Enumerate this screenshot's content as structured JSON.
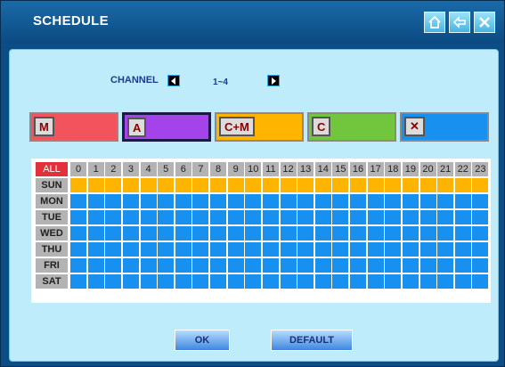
{
  "window": {
    "title": "SCHEDULE",
    "buttons": [
      {
        "name": "home-button",
        "icon": "home-icon"
      },
      {
        "name": "back-button",
        "icon": "back-arrow-icon"
      },
      {
        "name": "close-button",
        "icon": "close-icon"
      }
    ]
  },
  "channel": {
    "label": "CHANNEL",
    "value": "1~4"
  },
  "modes": [
    {
      "key": "m",
      "label": "M",
      "color": "#f2535c"
    },
    {
      "key": "a",
      "label": "A",
      "color": "#a543ea",
      "selected": true
    },
    {
      "key": "cm",
      "label": "C+M",
      "color": "#ffb400"
    },
    {
      "key": "c",
      "label": "C",
      "color": "#72c63d"
    },
    {
      "key": "none",
      "label": "✕",
      "color": "#1790f0"
    }
  ],
  "grid": {
    "all_label": "ALL",
    "hours": [
      "0",
      "1",
      "2",
      "3",
      "4",
      "5",
      "6",
      "7",
      "8",
      "9",
      "10",
      "11",
      "12",
      "13",
      "14",
      "15",
      "16",
      "17",
      "18",
      "19",
      "20",
      "21",
      "22",
      "23"
    ],
    "days": [
      {
        "label": "SUN",
        "mode": "cm"
      },
      {
        "label": "MON",
        "mode": "none"
      },
      {
        "label": "TUE",
        "mode": "none"
      },
      {
        "label": "WED",
        "mode": "none"
      },
      {
        "label": "THU",
        "mode": "none"
      },
      {
        "label": "FRI",
        "mode": "none"
      },
      {
        "label": "SAT",
        "mode": "none"
      }
    ]
  },
  "footer": {
    "ok_label": "OK",
    "default_label": "DEFAULT"
  }
}
